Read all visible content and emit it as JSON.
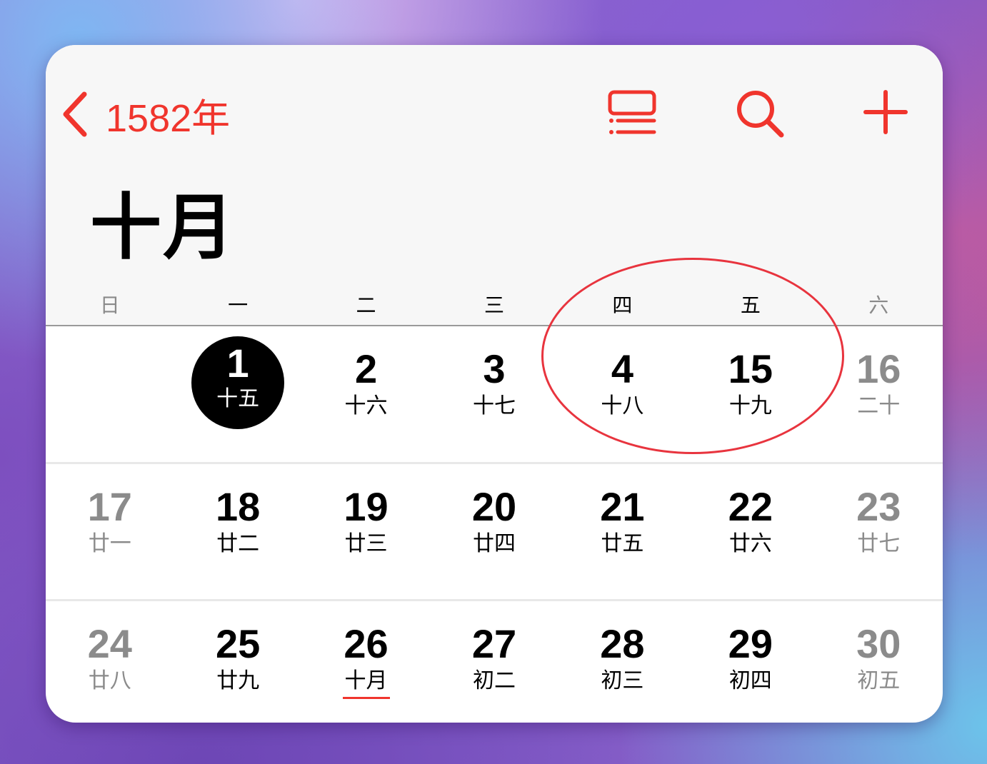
{
  "header": {
    "back_label": "1582年",
    "back_icon": "chevron-left-icon",
    "list_icon": "list-view-icon",
    "search_icon": "search-icon",
    "add_icon": "plus-icon",
    "accent_color": "#f0352d"
  },
  "month_title": "十月",
  "weekdays": [
    "日",
    "一",
    "二",
    "三",
    "四",
    "五",
    "六"
  ],
  "weeks": [
    [
      {
        "day": "",
        "lunar": ""
      },
      {
        "day": "1",
        "lunar": "十五"
      },
      {
        "day": "2",
        "lunar": "十六"
      },
      {
        "day": "3",
        "lunar": "十七"
      },
      {
        "day": "4",
        "lunar": "十八"
      },
      {
        "day": "15",
        "lunar": "十九"
      },
      {
        "day": "16",
        "lunar": "二十"
      }
    ],
    [
      {
        "day": "17",
        "lunar": "廿一"
      },
      {
        "day": "18",
        "lunar": "廿二"
      },
      {
        "day": "19",
        "lunar": "廿三"
      },
      {
        "day": "20",
        "lunar": "廿四"
      },
      {
        "day": "21",
        "lunar": "廿五"
      },
      {
        "day": "22",
        "lunar": "廿六"
      },
      {
        "day": "23",
        "lunar": "廿七"
      }
    ],
    [
      {
        "day": "24",
        "lunar": "廿八"
      },
      {
        "day": "25",
        "lunar": "廿九"
      },
      {
        "day": "26",
        "lunar": "十月"
      },
      {
        "day": "27",
        "lunar": "初二"
      },
      {
        "day": "28",
        "lunar": "初三"
      },
      {
        "day": "29",
        "lunar": "初四"
      },
      {
        "day": "30",
        "lunar": "初五"
      }
    ]
  ],
  "selected_day": "1",
  "lunar_month_start_day": "26",
  "annotation": {
    "color": "#e8343e",
    "highlighted_days": [
      "4",
      "15"
    ]
  }
}
